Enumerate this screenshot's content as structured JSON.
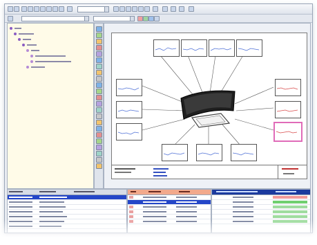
{
  "colors": {
    "tree_panel_bg": "#fffbe8",
    "selection_pink": "#e06bb8",
    "selection_green": "#6fcf6f",
    "header_orange": "#f2a98c",
    "row_highlight_blue": "#2446c8",
    "trace_blue": "#4d6fd6",
    "trace_red": "#d84a4a"
  },
  "toolbar": {
    "icon_names": [
      "new-icon",
      "open-icon",
      "save-icon",
      "print-icon",
      "cut-icon",
      "copy-icon",
      "paste-icon",
      "zoom-icon",
      "fit-icon",
      "grid-icon",
      "help-icon"
    ]
  },
  "tree": {
    "row_count": 6,
    "rows": [
      {
        "icon": "folder-icon"
      },
      {
        "icon": "node-icon"
      },
      {
        "icon": "node-icon"
      },
      {
        "icon": "node-icon"
      },
      {
        "icon": "item-icon"
      },
      {
        "icon": "item-icon"
      },
      {
        "icon": "item-icon"
      }
    ]
  },
  "diagram": {
    "chart_count": 13,
    "center_object": "monitor-screen-image"
  },
  "bottom_panels": {
    "left": {
      "column_count": 3
    },
    "middle": {
      "column_count": 3
    },
    "right": {
      "column_count": 3
    }
  }
}
